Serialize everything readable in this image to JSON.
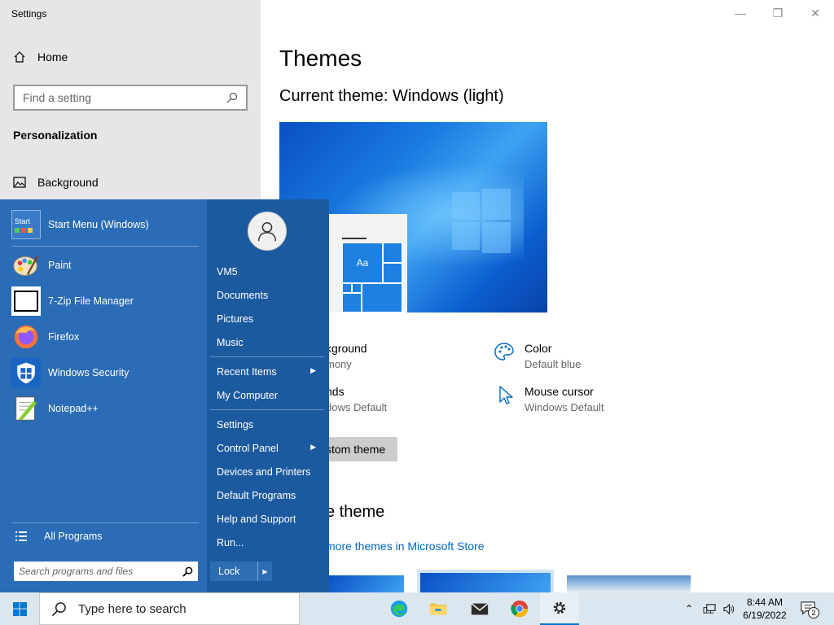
{
  "settings": {
    "window_title": "Settings",
    "home_label": "Home",
    "search_placeholder": "Find a setting",
    "section_heading": "Personalization",
    "nav_background": "Background",
    "page_title": "Themes",
    "current_theme": "Current theme: Windows (light)",
    "preview_tile_label": "Aa",
    "props": {
      "background_title": "kground",
      "background_value": "mony",
      "color_title": "Color",
      "color_value": "Default blue",
      "sounds_title": "nds",
      "sounds_value": "dows Default",
      "cursor_title": "Mouse cursor",
      "cursor_value": "Windows Default"
    },
    "custom_theme_button": "stom theme",
    "apply_heading": "e theme",
    "store_link": "more themes in Microsoft Store"
  },
  "start_menu": {
    "apps": [
      {
        "label": "Start Menu (Windows)",
        "icon": "start-menu-app-icon"
      },
      {
        "label": "Paint",
        "icon": "paint-icon"
      },
      {
        "label": "7-Zip File Manager",
        "icon": "7zip-icon"
      },
      {
        "label": "Firefox",
        "icon": "firefox-icon"
      },
      {
        "label": "Windows Security",
        "icon": "windows-security-icon"
      },
      {
        "label": "Notepad++",
        "icon": "notepadpp-icon"
      }
    ],
    "start_icon_text": "Start",
    "seven_zip_text": "7z",
    "all_programs": "All Programs",
    "search_placeholder": "Search programs and files",
    "right_items": {
      "user": "VM5",
      "documents": "Documents",
      "pictures": "Pictures",
      "music": "Music",
      "recent_items": "Recent Items",
      "my_computer": "My Computer",
      "settings": "Settings",
      "control_panel": "Control Panel",
      "devices_printers": "Devices and Printers",
      "default_programs": "Default Programs",
      "help_support": "Help and Support",
      "run": "Run..."
    },
    "lock_label": "Lock"
  },
  "taskbar": {
    "search_placeholder": "Type here to search",
    "time": "8:44 AM",
    "date": "6/19/2022",
    "notification_count": "2",
    "pinned": [
      "edge-icon",
      "file-explorer-icon",
      "mail-icon",
      "chrome-icon",
      "settings-gear-icon"
    ],
    "active_app": "settings-gear-icon"
  },
  "colors": {
    "start_menu_bg": "#2a6cb5",
    "accent": "#0078d4",
    "link": "#0067c0"
  }
}
